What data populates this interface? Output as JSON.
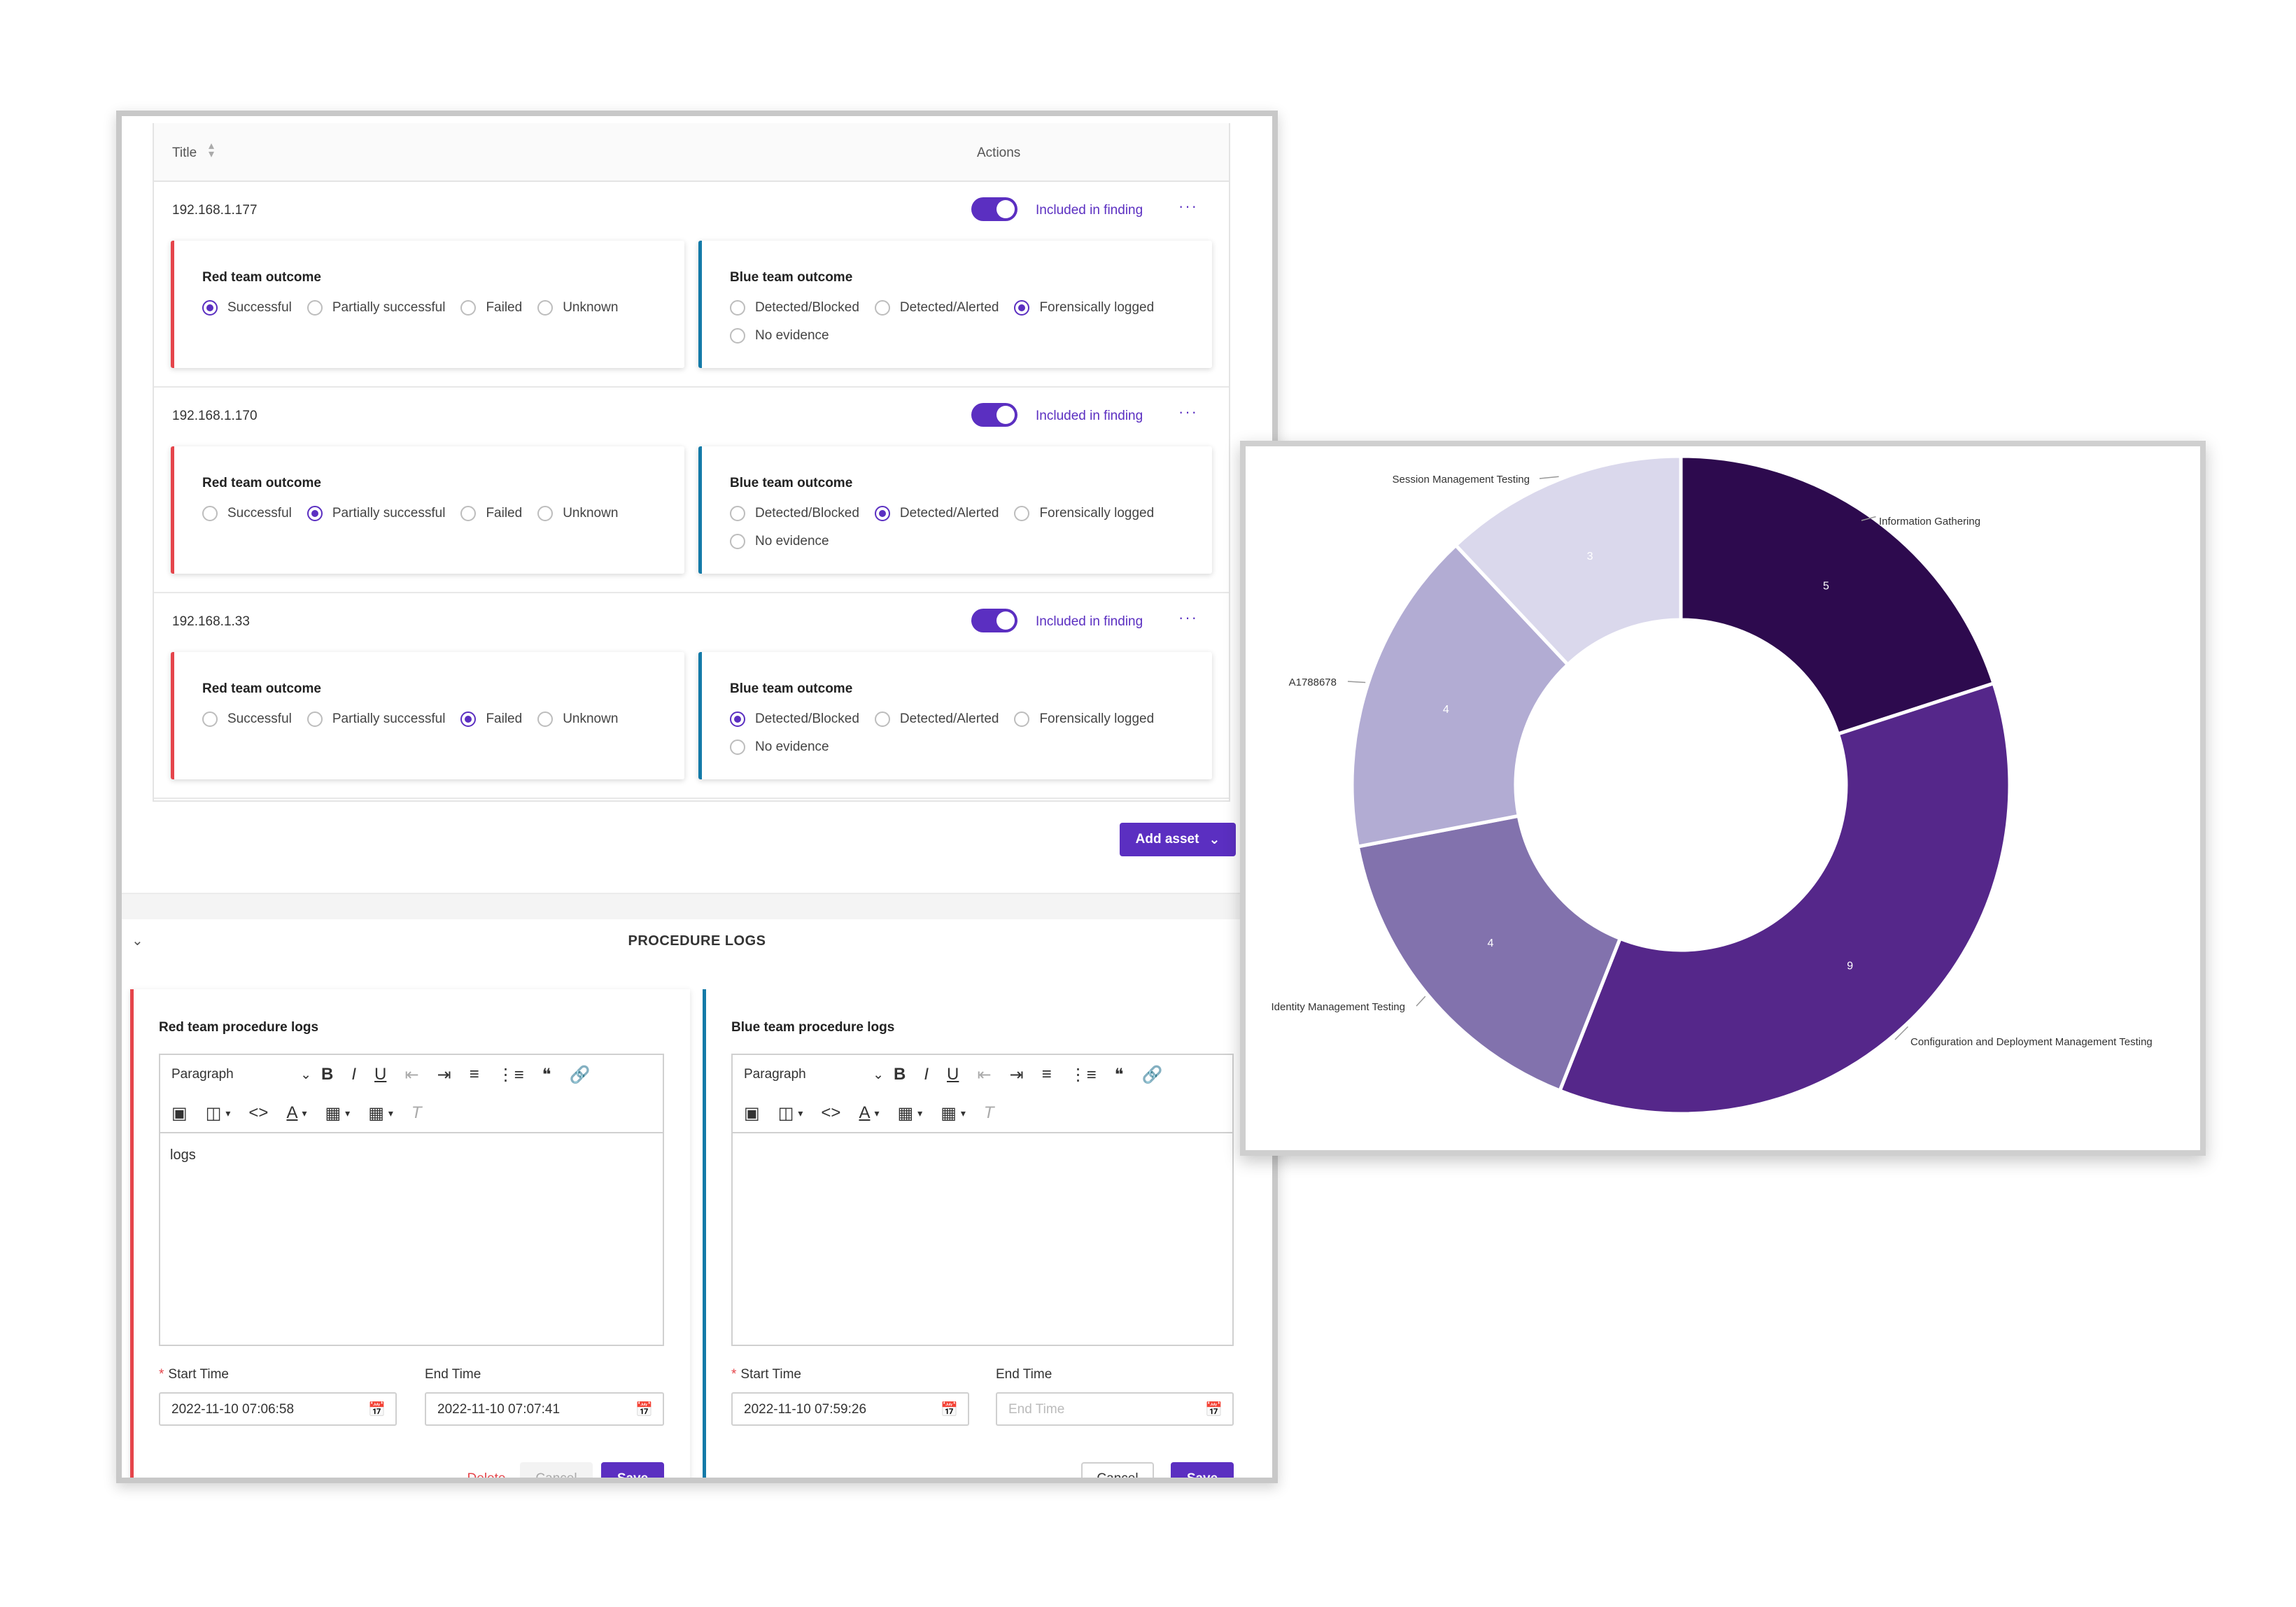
{
  "table": {
    "col_title": "Title",
    "col_actions": "Actions",
    "assets": [
      {
        "ip": "192.168.1.177",
        "included_label": "Included in finding",
        "red": {
          "title": "Red team outcome",
          "options": [
            "Successful",
            "Partially successful",
            "Failed",
            "Unknown"
          ],
          "selected": 0
        },
        "blue": {
          "title": "Blue team outcome",
          "options": [
            "Detected/Blocked",
            "Detected/Alerted",
            "Forensically logged",
            "No evidence"
          ],
          "selected": 2
        }
      },
      {
        "ip": "192.168.1.170",
        "included_label": "Included in finding",
        "red": {
          "title": "Red team outcome",
          "options": [
            "Successful",
            "Partially successful",
            "Failed",
            "Unknown"
          ],
          "selected": 1
        },
        "blue": {
          "title": "Blue team outcome",
          "options": [
            "Detected/Blocked",
            "Detected/Alerted",
            "Forensically logged",
            "No evidence"
          ],
          "selected": 1
        }
      },
      {
        "ip": "192.168.1.33",
        "included_label": "Included in finding",
        "red": {
          "title": "Red team outcome",
          "options": [
            "Successful",
            "Partially successful",
            "Failed",
            "Unknown"
          ],
          "selected": 2
        },
        "blue": {
          "title": "Blue team outcome",
          "options": [
            "Detected/Blocked",
            "Detected/Alerted",
            "Forensically logged",
            "No evidence"
          ],
          "selected": 0
        }
      }
    ],
    "add_asset_label": "Add asset"
  },
  "procedure": {
    "title": "PROCEDURE LOGS",
    "red": {
      "title": "Red team procedure logs",
      "paragraph_select": "Paragraph",
      "content": "logs",
      "start_label": "Start Time",
      "start_value": "2022-11-10 07:06:58",
      "end_label": "End Time",
      "end_value": "2022-11-10 07:07:41",
      "delete_label": "Delete",
      "cancel_label": "Cancel",
      "save_label": "Save"
    },
    "blue": {
      "title": "Blue team procedure logs",
      "paragraph_select": "Paragraph",
      "content": "",
      "start_label": "Start Time",
      "start_value": "2022-11-10 07:59:26",
      "end_label": "End Time",
      "end_placeholder": "End Time",
      "cancel_label": "Cancel",
      "save_label": "Save"
    }
  },
  "colors": {
    "accent": "#5b2fc1",
    "red_team": "#e5454b",
    "blue_team": "#137aa8"
  },
  "chart_data": {
    "type": "pie",
    "donut": true,
    "slices": [
      {
        "label": "Information Gathering",
        "value": 5,
        "color": "#2d0a4e"
      },
      {
        "label": "Configuration and Deployment Management Testing",
        "value": 9,
        "color": "#55278a"
      },
      {
        "label": "Identity Management Testing",
        "value": 4,
        "color": "#8272ad"
      },
      {
        "label": "A1788678",
        "value": 4,
        "color": "#b2acd3"
      },
      {
        "label": "Session Management Testing",
        "value": 3,
        "color": "#dad8ec"
      }
    ]
  }
}
